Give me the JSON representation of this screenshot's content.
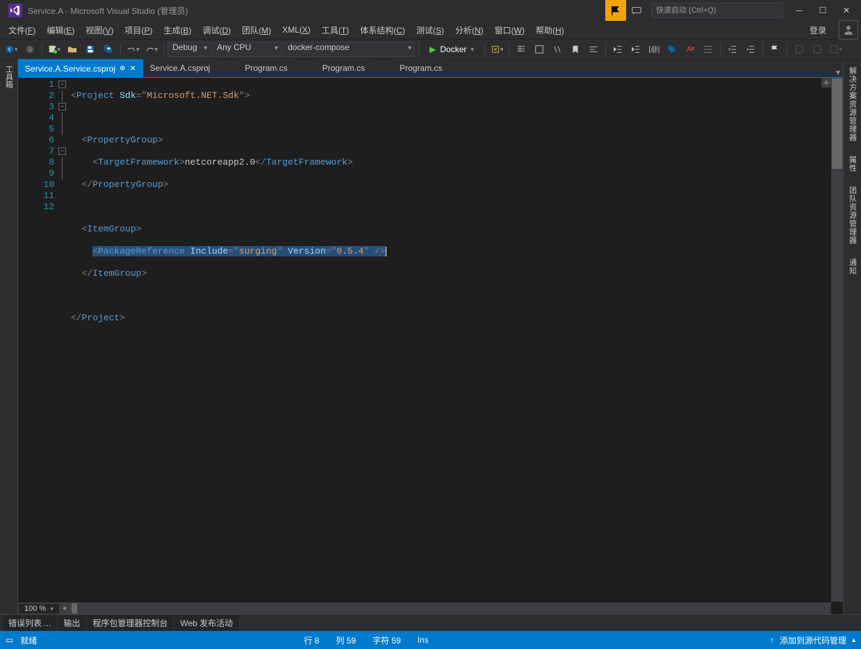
{
  "title": "Service.A - Microsoft Visual Studio (管理员)",
  "quick_launch_placeholder": "快速启动 (Ctrl+Q)",
  "menu": {
    "file": {
      "label": "文件",
      "key": "F"
    },
    "edit": {
      "label": "编辑",
      "key": "E"
    },
    "view": {
      "label": "视图",
      "key": "V"
    },
    "project": {
      "label": "项目",
      "key": "P"
    },
    "build": {
      "label": "生成",
      "key": "B"
    },
    "debug": {
      "label": "调试",
      "key": "D"
    },
    "team": {
      "label": "团队",
      "key": "M"
    },
    "xml": {
      "label": "XML",
      "key": "X"
    },
    "tools": {
      "label": "工具",
      "key": "T"
    },
    "arch": {
      "label": "体系结构",
      "key": "C"
    },
    "test": {
      "label": "测试",
      "key": "S"
    },
    "analyze": {
      "label": "分析",
      "key": "N"
    },
    "window": {
      "label": "窗口",
      "key": "W"
    },
    "help": {
      "label": "帮助",
      "key": "H"
    },
    "login": "登录"
  },
  "toolbar": {
    "config": "Debug",
    "platform": "Any CPU",
    "startup": "docker-compose",
    "start": "Docker"
  },
  "side": {
    "toolbox": "工具箱"
  },
  "right_side": {
    "solution_explorer": "解决方案资源管理器",
    "properties": "属性",
    "team_explorer": "团队资源管理器",
    "notifications": "通知"
  },
  "tabs": [
    {
      "label": "Service.A.Service.csproj",
      "active": true,
      "pinned": true
    },
    {
      "label": "Service.A.csproj",
      "active": false
    },
    {
      "label": "Program.cs",
      "active": false
    },
    {
      "label": "Program.cs",
      "active": false
    },
    {
      "label": "Program.cs",
      "active": false
    }
  ],
  "zoom": "100 %",
  "code": {
    "lines": 12,
    "selected_line": 8
  },
  "bottom_tabs": [
    "错误列表 ...",
    "输出",
    "程序包管理器控制台",
    "Web 发布活动"
  ],
  "status": {
    "ready": "就绪",
    "line": "行 8",
    "col": "列 59",
    "char": "字符 59",
    "ins": "Ins",
    "scm": "添加到源代码管理"
  }
}
